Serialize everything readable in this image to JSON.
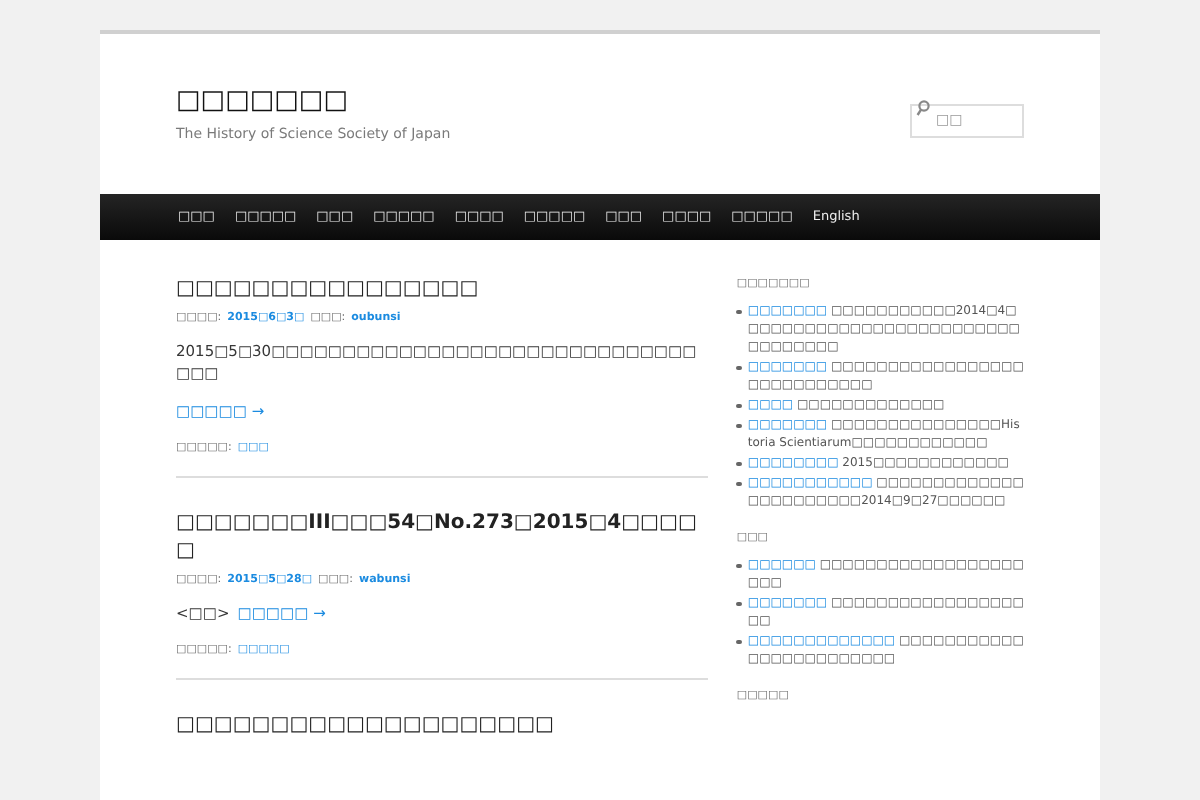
{
  "site": {
    "title": "□□□□□□□",
    "tagline": "The History of Science Society of Japan",
    "search": {
      "placeholder": "□□"
    }
  },
  "nav": [
    "□□□",
    "□□□□□",
    "□□□",
    "□□□□□",
    "□□□□",
    "□□□□□",
    "□□□",
    "□□□□",
    "□□□□□",
    "English"
  ],
  "posts": [
    {
      "title": "□□□□□□□□□□□□□□□□",
      "meta": [
        {
          "label": "□□□□:",
          "value": "2015□6□3□"
        },
        {
          "label": "□□□:",
          "value": "oubunsi"
        }
      ],
      "body": "2015□5□30□□□□□□□□□□□□□□□□□□□□□□□□□□□□□□□□□",
      "more": "□□□□□ →",
      "category_label": "□□□□□:",
      "category": "□□□"
    },
    {
      "title": "□□□□□□□III□□□54□No.273□2015□4□□□□□",
      "meta": [
        {
          "label": "□□□□:",
          "value": "2015□5□28□"
        },
        {
          "label": "□□□:",
          "value": "wabunsi"
        }
      ],
      "lead": "<□□>",
      "more": "□□□□□ →",
      "category_label": "□□□□□:",
      "category": "□□□□□"
    },
    {
      "title": "□□□□□□□□□□□□□□□□□□□□"
    }
  ],
  "sidebar": [
    {
      "heading": "□□□□□□□",
      "items": [
        {
          "link": "□□□□□□□",
          "text": "□□□□□□□□□□□2014□4□□□□□□□□□□□□□□□□□□□□□□□□□□□□□□□□□"
        },
        {
          "link": "□□□□□□□",
          "text": "□□□□□□□□□□□□□□□□□□□□□□□□□□□□"
        },
        {
          "link": "□□□□",
          "text": "□□□□□□□□□□□□□"
        },
        {
          "link": "□□□□□□□",
          "text": "□□□□□□□□□□□□□□□Historia Scientiarum□□□□□□□□□□□□"
        },
        {
          "link": "□□□□□□□□",
          "text": "2015□□□□□□□□□□□□"
        },
        {
          "link": "□□□□□□□□□□□",
          "text": "□□□□□□□□□□□□□□□□□□□□□□□2014□9□27□□□□□□"
        }
      ]
    },
    {
      "heading": "□□□",
      "items": [
        {
          "link": "□□□□□□",
          "text": "□□□□□□□□□□□□□□□□□□□□□"
        },
        {
          "link": "□□□□□□□",
          "text": "□□□□□□□□□□□□□□□□□□□"
        },
        {
          "link": "□□□□□□□□□□□□□",
          "text": "□□□□□□□□□□□□□□□□□□□□□□□□"
        }
      ]
    },
    {
      "heading": "□□□□□"
    }
  ]
}
